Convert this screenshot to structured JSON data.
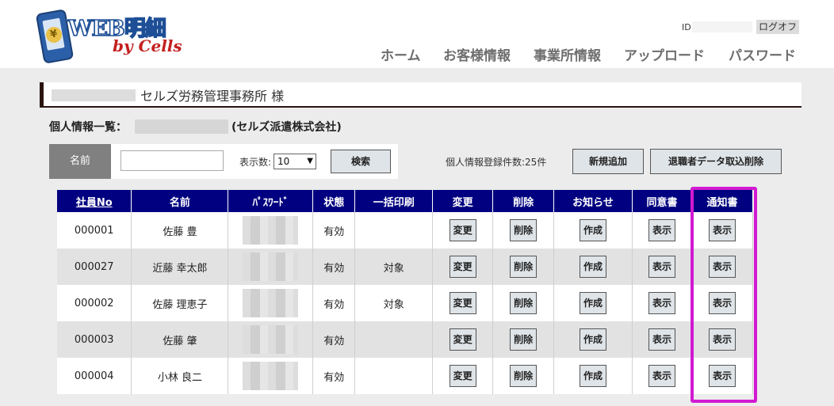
{
  "header": {
    "logo": {
      "title": "WEB明細",
      "subtitle": "by Cells",
      "badge": "¥"
    },
    "id_label": "ID:",
    "logout_label": "ログオフ",
    "nav": [
      "ホーム",
      "お客様情報",
      "事業所情報",
      "アップロード",
      "パスワード"
    ]
  },
  "client": {
    "name": "セルズ労務管理事務所 様"
  },
  "list": {
    "title": "個人情報一覧：",
    "company": "(セルズ派遣株式会社)"
  },
  "search": {
    "name_label": "名前",
    "name_value": "",
    "count_label": "表示数:",
    "count_value": "10",
    "search_button": "検索"
  },
  "registered_count": "個人情報登録件数:25件",
  "buttons": {
    "new": "新規追加",
    "retire_import_delete": "退職者データ取込削除"
  },
  "table": {
    "headers": [
      "社員No",
      "名前",
      "ﾊﾟｽﾜｰﾄﾞ",
      "状態",
      "一括印刷",
      "変更",
      "削除",
      "お知らせ",
      "同意書",
      "通知書"
    ],
    "rows": [
      {
        "no": "000001",
        "name": "佐藤 豊",
        "status": "有効",
        "bulk": "",
        "change": "変更",
        "delete": "削除",
        "notice": "作成",
        "consent": "表示",
        "notification": "表示"
      },
      {
        "no": "000027",
        "name": "近藤 幸太郎",
        "status": "有効",
        "bulk": "対象",
        "change": "変更",
        "delete": "削除",
        "notice": "作成",
        "consent": "表示",
        "notification": "表示"
      },
      {
        "no": "000002",
        "name": "佐藤 理恵子",
        "status": "有効",
        "bulk": "対象",
        "change": "変更",
        "delete": "削除",
        "notice": "作成",
        "consent": "表示",
        "notification": "表示"
      },
      {
        "no": "000003",
        "name": "佐藤 肇",
        "status": "有効",
        "bulk": "",
        "change": "変更",
        "delete": "削除",
        "notice": "作成",
        "consent": "表示",
        "notification": "表示"
      },
      {
        "no": "000004",
        "name": "小林 良二",
        "status": "有効",
        "bulk": "",
        "change": "変更",
        "delete": "削除",
        "notice": "作成",
        "consent": "表示",
        "notification": "表示"
      }
    ]
  },
  "colors": {
    "table_header": "#000080",
    "highlight": "#d11ad1",
    "logo_blue": "#1d4e96",
    "logo_red": "#c3201f"
  }
}
